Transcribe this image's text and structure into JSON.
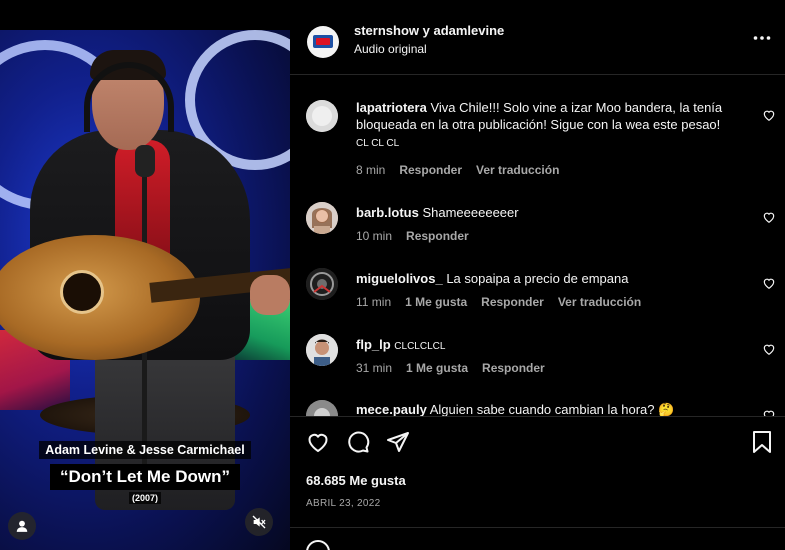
{
  "video": {
    "caption_names": "Adam Levine & Jesse Carmichael",
    "caption_song": "“Don’t Let Me Down”",
    "caption_year": "(2007)",
    "icons": [
      "user-icon",
      "muted-speaker-icon"
    ]
  },
  "header": {
    "users": "sternshow y adamlevine",
    "audio": "Audio original",
    "more_icon": "more-icon"
  },
  "comments": [
    {
      "username": "lapatriotera",
      "text": "Viva Chile!!! Solo vine a izar Moo bandera, la tenía bloqueada en la otra publicación! Sigue con la wea este pesao!",
      "extra": "CL CL CL",
      "time": "8 min",
      "likes": "",
      "reply": "Responder",
      "translate": "Ver traducción"
    },
    {
      "username": "barb.lotus",
      "text": "Shameeeeeeeer",
      "extra": "",
      "time": "10 min",
      "likes": "",
      "reply": "Responder",
      "translate": ""
    },
    {
      "username": "miguelolivos_",
      "text": "La sopaipa a precio de empana",
      "extra": "",
      "time": "11 min",
      "likes": "1 Me gusta",
      "reply": "Responder",
      "translate": "Ver traducción"
    },
    {
      "username": "flp_lp",
      "text": "",
      "extra": "CLCLCLCL",
      "time": "31 min",
      "likes": "1 Me gusta",
      "reply": "Responder",
      "translate": ""
    },
    {
      "username": "mece.pauly",
      "text": "Alguien sabe cuando cambian la hora? 🤔",
      "extra": "",
      "time": "",
      "likes": "",
      "reply": "",
      "translate": ""
    }
  ],
  "footer": {
    "likes": "68.685 Me gusta",
    "date": "ABRIL 23, 2022"
  },
  "colors": {
    "background": "#000000",
    "text": "#f5f5f5",
    "muted_text": "#a8a8a8",
    "divider": "#262626"
  }
}
